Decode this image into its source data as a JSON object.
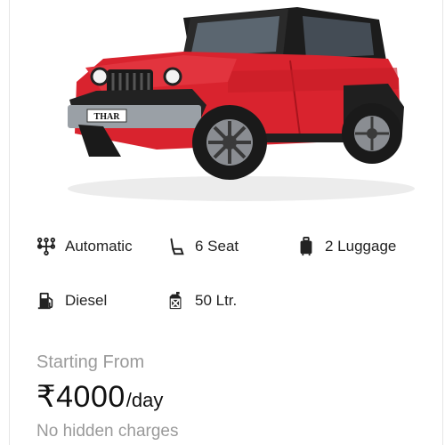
{
  "car": {
    "badge_text": "THAR",
    "colors": {
      "body": "#d9232e",
      "body_dark": "#a8141d",
      "roof": "#1c1c1c",
      "tyre": "#1a1a1a",
      "rim": "#8a8d92"
    }
  },
  "specs": {
    "transmission": {
      "label": "Automatic",
      "icon": "gearshift-icon"
    },
    "seats": {
      "label": "6 Seat",
      "icon": "seat-icon"
    },
    "luggage": {
      "label": "2 Luggage",
      "icon": "luggage-icon"
    },
    "fuel": {
      "label": "Diesel",
      "icon": "fuel-pump-icon"
    },
    "tank": {
      "label": "50 Ltr.",
      "icon": "jerrycan-icon"
    }
  },
  "pricing": {
    "starting_from": "Starting From",
    "price": "₹4000",
    "unit": "/day",
    "note": "No hidden charges"
  }
}
